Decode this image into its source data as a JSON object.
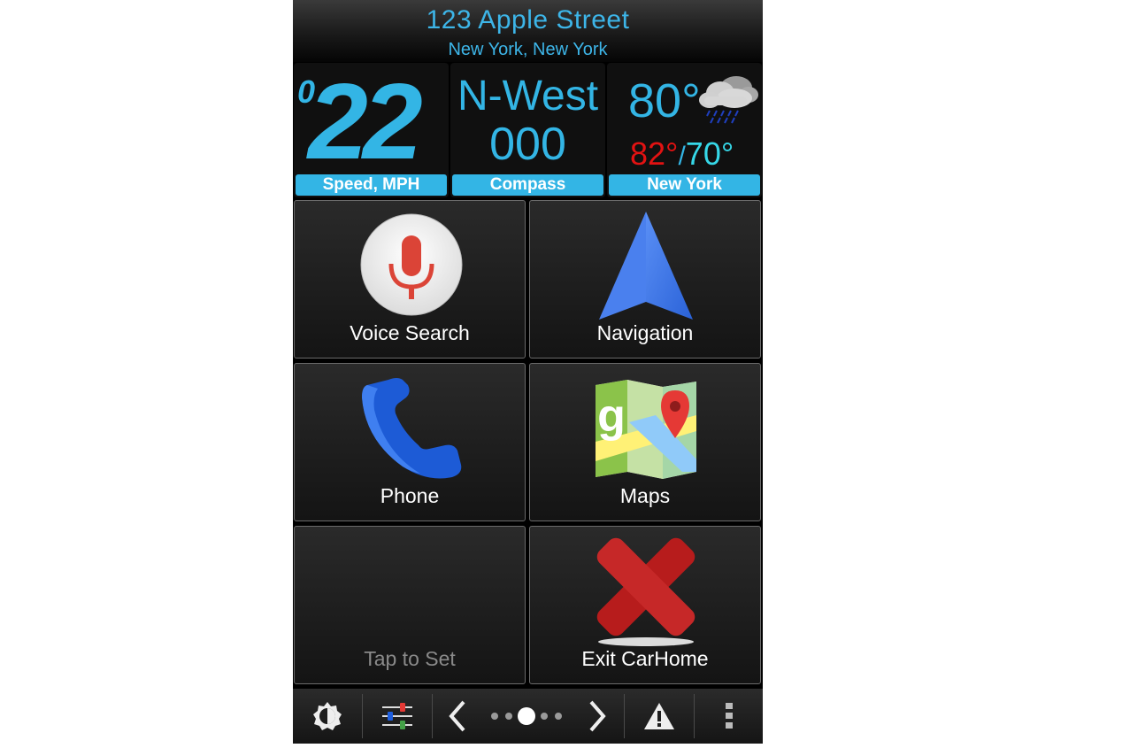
{
  "header": {
    "address": "123 Apple Street",
    "city": "New York, New York"
  },
  "widgets": {
    "speed": {
      "prefix": "0",
      "value": "22",
      "label": "Speed, MPH"
    },
    "compass": {
      "direction": "N-West",
      "degrees": "000",
      "label": "Compass"
    },
    "weather": {
      "current": "80°",
      "high": "82°",
      "separator": "/",
      "low": "70°",
      "label": "New York"
    }
  },
  "tiles": {
    "voice_search": "Voice Search",
    "navigation": "Navigation",
    "phone": "Phone",
    "maps": "Maps",
    "tap_to_set": "Tap to Set",
    "exit": "Exit CarHome"
  },
  "bottom_bar": {
    "icons": [
      "brightness-icon",
      "settings-sliders-icon",
      "chevron-left-icon",
      "page-dots",
      "chevron-right-icon",
      "warning-icon",
      "overflow-menu-icon"
    ],
    "active_page": 3,
    "page_count": 5
  },
  "colors": {
    "accent": "#33b5e5",
    "high_temp": "#e21212",
    "low_temp": "#36d8e8"
  }
}
